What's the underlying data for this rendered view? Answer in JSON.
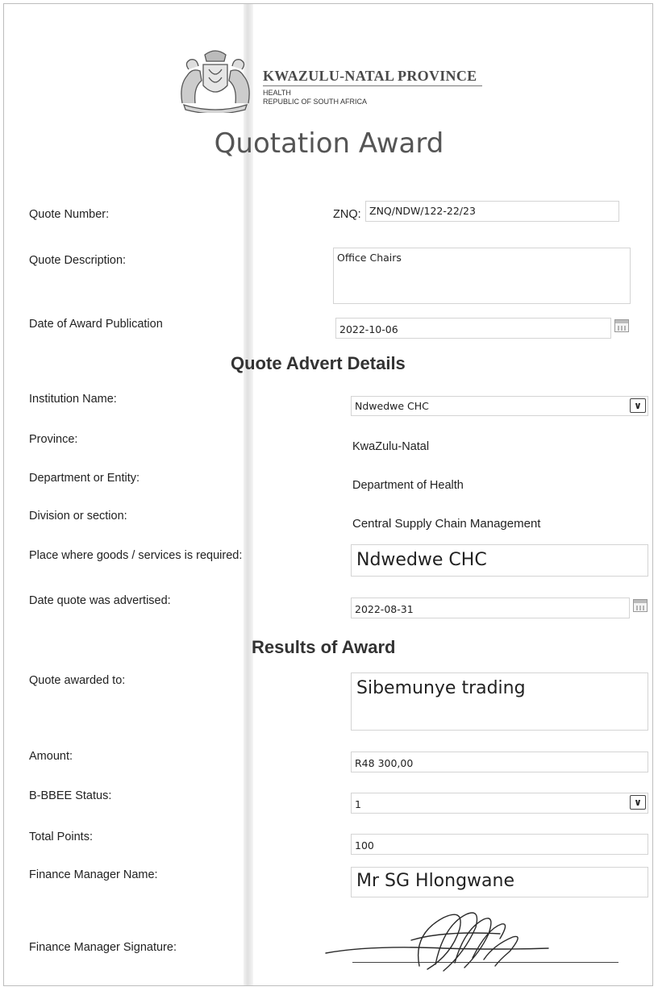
{
  "header": {
    "province": "KWAZULU-NATAL PROVINCE",
    "department": "HEALTH",
    "country": "REPUBLIC OF SOUTH AFRICA"
  },
  "title": "Quotation Award",
  "quote": {
    "number_label": "Quote Number:",
    "number_prefix": "ZNQ:",
    "number_value": "ZNQ/NDW/122-22/23",
    "description_label": "Quote Description:",
    "description_value": "Office Chairs",
    "publication_label": "Date of Award Publication",
    "publication_value": "2022-10-06"
  },
  "advert": {
    "heading": "Quote Advert Details",
    "institution_label": "Institution Name:",
    "institution_value": "Ndwedwe CHC",
    "province_label": "Province:",
    "province_value": "KwaZulu-Natal",
    "department_label": "Department or Entity:",
    "department_value": "Department of Health",
    "division_label": "Division or section:",
    "division_value": "Central Supply Chain Management",
    "place_label": "Place where goods /  services is required:",
    "place_value": "Ndwedwe CHC",
    "advertised_label": "Date quote was advertised:",
    "advertised_value": "2022-08-31"
  },
  "results": {
    "heading": "Results of Award",
    "awarded_label": "Quote awarded to:",
    "awarded_value": "Sibemunye trading",
    "amount_label": "Amount:",
    "amount_value": "R48 300,00",
    "bbbee_label": "B-BBEE Status:",
    "bbbee_value": "1",
    "points_label": "Total Points:",
    "points_value": "100",
    "manager_label": "Finance Manager Name:",
    "manager_value": "Mr SG Hlongwane",
    "signature_label": "Finance Manager Signature:"
  },
  "icons": {
    "dropdown": "chevron-down-icon",
    "calendar": "calendar-icon",
    "emblem": "coat-of-arms-icon",
    "signature": "handwritten-signature"
  }
}
